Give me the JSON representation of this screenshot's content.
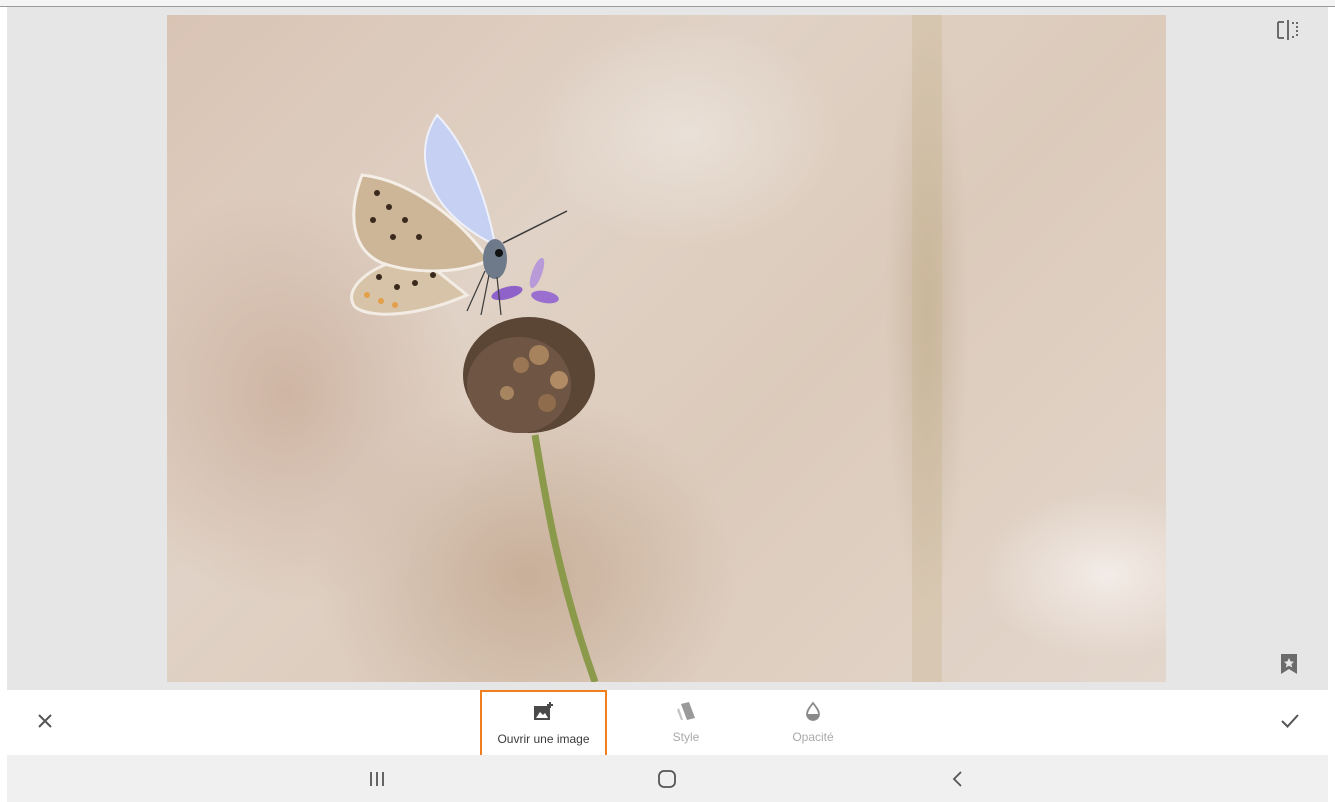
{
  "editor": {
    "photo_description_alt": "Papillon sur une fleur",
    "compare_icon": "compare-split-icon",
    "bookmark_icon": "bookmark-star-icon"
  },
  "toolbar": {
    "close_icon": "close-icon",
    "apply_icon": "check-icon",
    "tools": [
      {
        "label": "Ouvrir une image",
        "icon": "add-image-icon",
        "active": true
      },
      {
        "label": "Style",
        "icon": "style-layers-icon",
        "active": false
      },
      {
        "label": "Opacité",
        "icon": "opacity-drop-icon",
        "active": false
      }
    ],
    "highlight_color": "#f07f1e"
  },
  "navigation_bar": {
    "buttons": [
      "recent-apps-icon",
      "home-icon",
      "back-icon"
    ]
  }
}
